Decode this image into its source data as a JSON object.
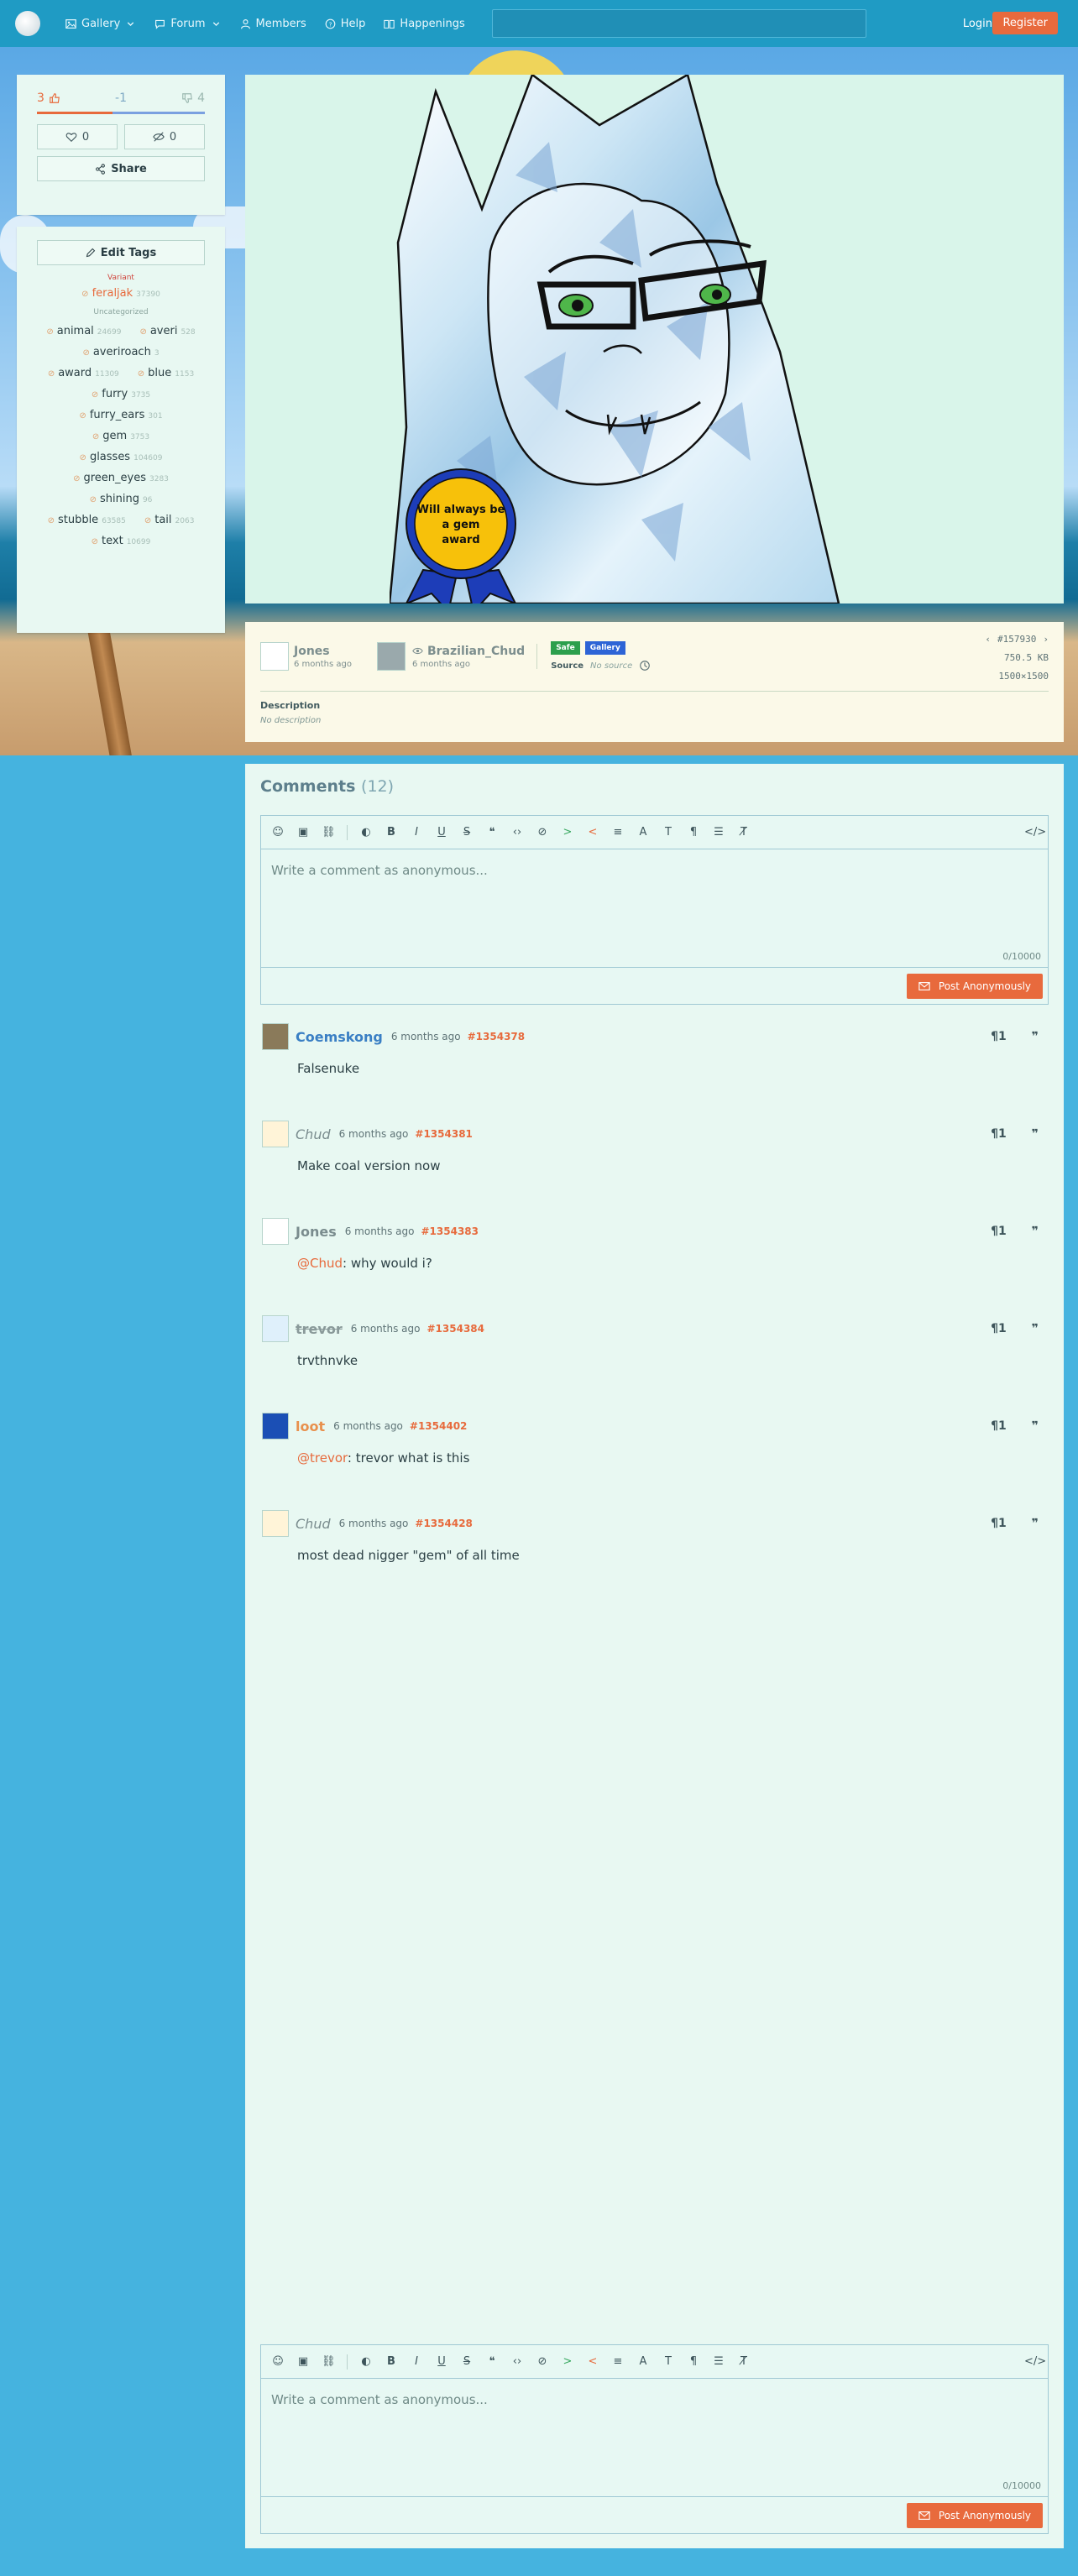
{
  "nav": {
    "items": [
      {
        "label": "Gallery"
      },
      {
        "label": "Forum"
      },
      {
        "label": "Members"
      },
      {
        "label": "Help"
      },
      {
        "label": "Happenings"
      }
    ],
    "login": "Login",
    "register": "Register"
  },
  "votes": {
    "up": "3",
    "score": "-1",
    "faves_heart": "4",
    "fave_count": "0",
    "hide_count": "0",
    "share_label": "Share"
  },
  "tags": {
    "edit_label": "Edit Tags",
    "variant_title": "Variant",
    "uncategorized_title": "Uncategorized",
    "variant": [
      {
        "name": "feraljak",
        "count": "37390"
      }
    ],
    "rows": [
      [
        {
          "name": "animal",
          "count": "24699"
        },
        {
          "name": "averi",
          "count": "528"
        }
      ],
      [
        {
          "name": "averiroach",
          "count": "3"
        }
      ],
      [
        {
          "name": "award",
          "count": "11309"
        },
        {
          "name": "blue",
          "count": "1153"
        }
      ],
      [
        {
          "name": "furry",
          "count": "3735"
        }
      ],
      [
        {
          "name": "furry_ears",
          "count": "301"
        }
      ],
      [
        {
          "name": "gem",
          "count": "3753"
        }
      ],
      [
        {
          "name": "glasses",
          "count": "104609"
        }
      ],
      [
        {
          "name": "green_eyes",
          "count": "3283"
        }
      ],
      [
        {
          "name": "shining",
          "count": "96"
        }
      ],
      [
        {
          "name": "stubble",
          "count": "63585"
        },
        {
          "name": "tail",
          "count": "2063"
        }
      ],
      [
        {
          "name": "text",
          "count": "10699"
        }
      ]
    ]
  },
  "image": {
    "award_text": [
      "Will always be",
      "a gem",
      "award"
    ]
  },
  "info": {
    "uploader": "Jones",
    "uploader_date": "6 months ago",
    "editor": "Brazilian_Chud",
    "editor_date": "6 months ago",
    "badge_safe": "Safe",
    "badge_gallery": "Gallery",
    "source_label": "Source",
    "source_value": "No source",
    "post_number": "#157930",
    "file_size": "750.5 KB",
    "dimensions": "1500×1500",
    "description_label": "Description",
    "description_value": "No description"
  },
  "comments": {
    "title": "Comments",
    "count": "(12)",
    "placeholder": "Write a comment as anonymous...",
    "counter": "0/10000",
    "post_label": "Post Anonymously",
    "list": [
      {
        "author": "Coemskong",
        "time": "6 months ago",
        "id": "#1354378",
        "text": "Falsenuke",
        "mention": ""
      },
      {
        "author": "Chud",
        "time": "6 months ago",
        "id": "#1354381",
        "text": "Make coal version now",
        "mention": ""
      },
      {
        "author": "Jones",
        "time": "6 months ago",
        "id": "#1354383",
        "text": ": why would i?",
        "mention": "@Chud"
      },
      {
        "author": "trevor",
        "time": "6 months ago",
        "id": "#1354384",
        "text": "trvthnvke",
        "mention": ""
      },
      {
        "author": "loot",
        "time": "6 months ago",
        "id": "#1354402",
        "text": ": trevor what is this",
        "mention": "@trevor"
      },
      {
        "author": "Chud",
        "time": "6 months ago",
        "id": "#1354428",
        "text": "most dead nigger \"gem\" of all time",
        "mention": ""
      }
    ]
  },
  "colors": {
    "accent": "#e86a3d",
    "nav": "#1f9bc4",
    "panel": "#e8f8f2"
  }
}
